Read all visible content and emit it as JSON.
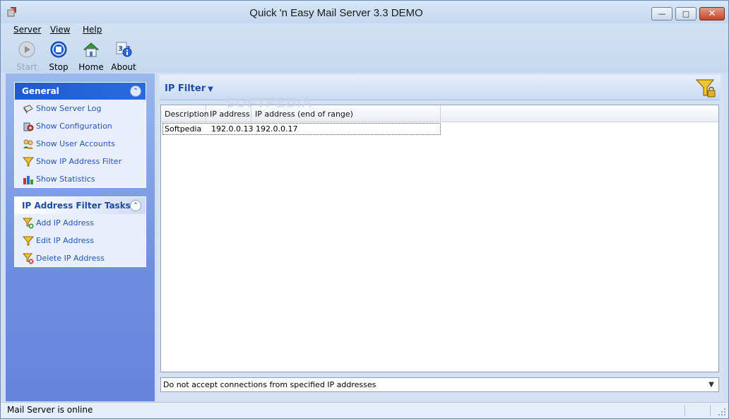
{
  "window": {
    "title": "Quick 'n Easy Mail Server 3.3 DEMO",
    "min_glyph": "—",
    "max_glyph": "□",
    "close_glyph": "✕"
  },
  "menu": {
    "server": "Server",
    "view": "View",
    "help": "Help"
  },
  "toolbar": {
    "start": "Start",
    "stop": "Stop",
    "home": "Home",
    "about": "About"
  },
  "sidebar": {
    "general": {
      "title": "General",
      "items": [
        {
          "label": "Show Server Log",
          "icon": "server-log-icon"
        },
        {
          "label": "Show Configuration",
          "icon": "configuration-icon"
        },
        {
          "label": "Show User Accounts",
          "icon": "user-accounts-icon"
        },
        {
          "label": "Show IP Address Filter",
          "icon": "funnel-icon"
        },
        {
          "label": "Show Statistics",
          "icon": "statistics-icon"
        }
      ]
    },
    "tasks": {
      "title": "IP Address Filter Tasks",
      "items": [
        {
          "label": "Add IP Address",
          "icon": "funnel-add-icon"
        },
        {
          "label": "Edit IP Address",
          "icon": "funnel-edit-icon"
        },
        {
          "label": "Delete IP Address",
          "icon": "funnel-delete-icon"
        }
      ]
    }
  },
  "content": {
    "title": "IP Filter",
    "caret": "▼",
    "watermark": "SOFTPEDIA",
    "columns": [
      "Description",
      "IP address",
      "IP address (end of range)"
    ],
    "rows": [
      [
        "Softpedia",
        "192.0.0.13",
        "192.0.0.17"
      ]
    ],
    "filter_mode": "Do not accept connections from specified IP addresses",
    "dropdown_arrow": "▼"
  },
  "status": {
    "text": "Mail Server is online"
  },
  "colors": {
    "sidebar_top": "#9bb8ec",
    "sidebar_bottom": "#6585dc",
    "panel_head": "#1f5bd0",
    "link": "#2156b8"
  }
}
